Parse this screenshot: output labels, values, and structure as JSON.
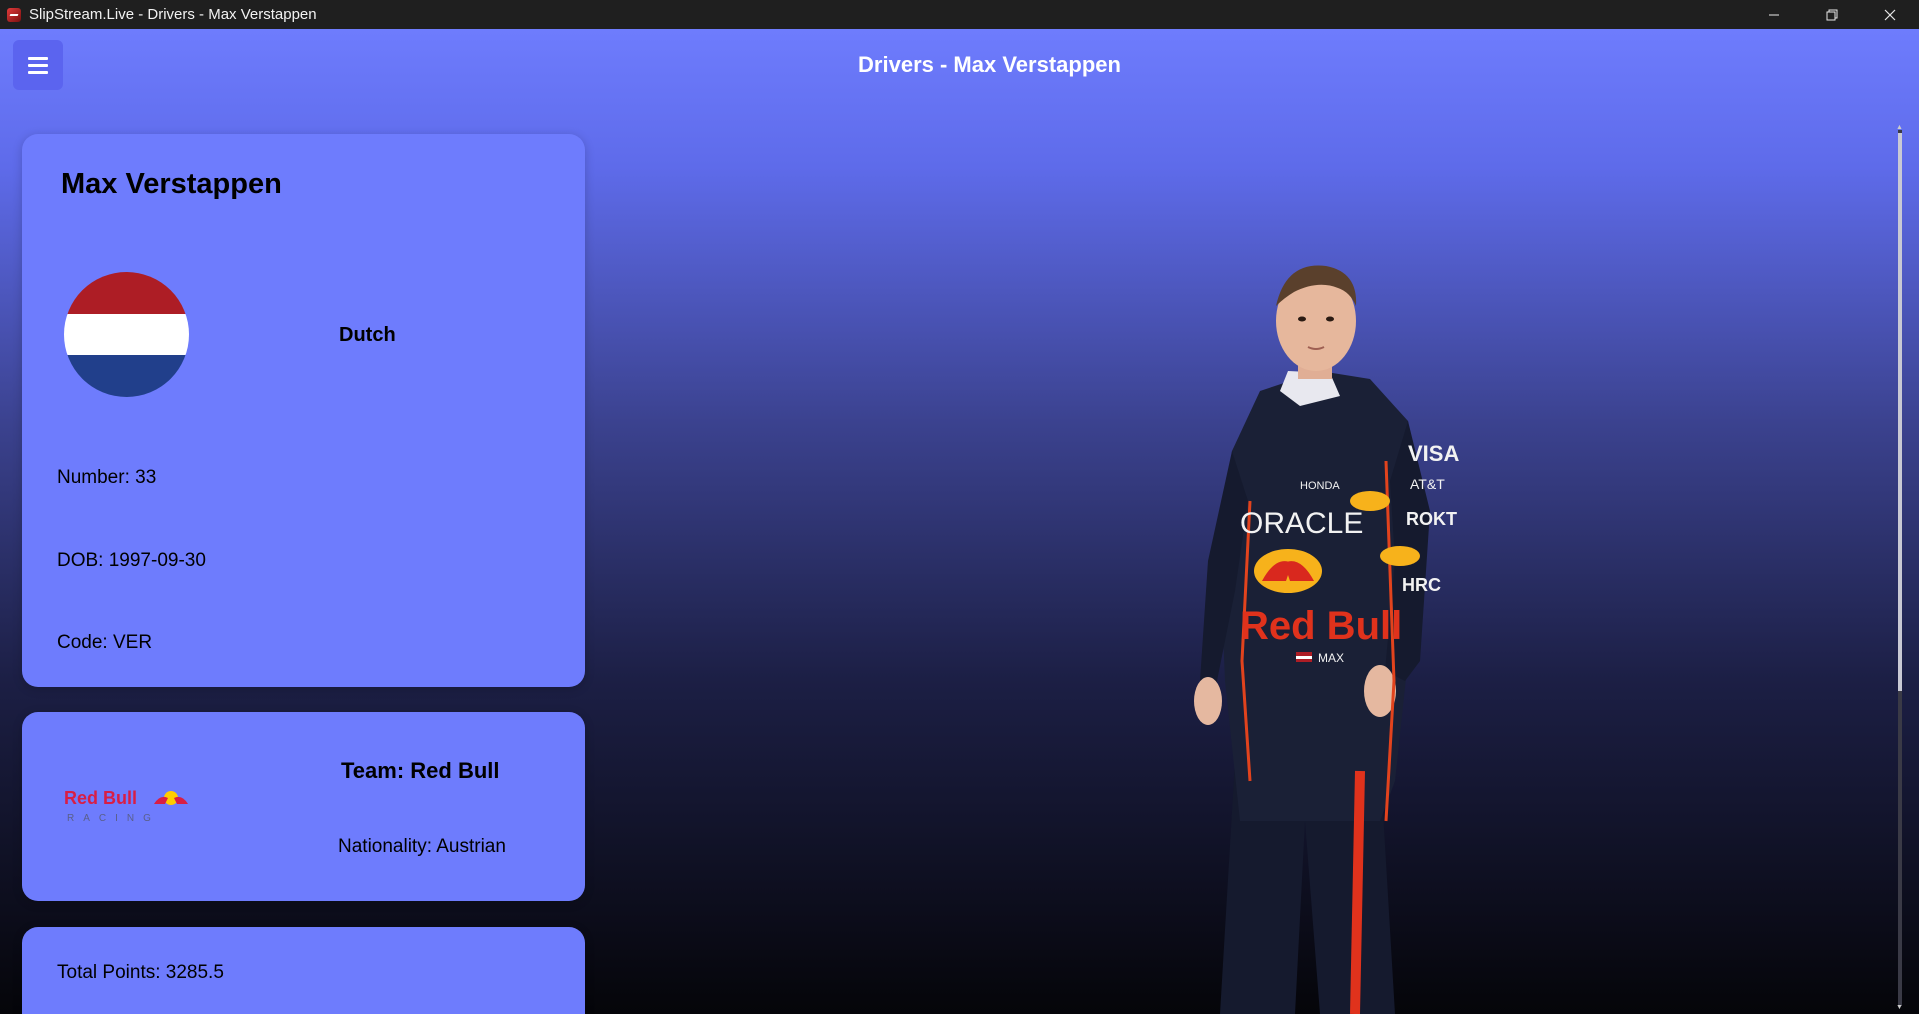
{
  "window": {
    "title": "SlipStream.Live - Drivers - Max Verstappen",
    "controls": {
      "minimize": "—",
      "restore": "❐",
      "close": "✕"
    }
  },
  "header": {
    "page_title": "Drivers - Max Verstappen",
    "menu_icon": "hamburger-menu-icon"
  },
  "driver": {
    "name": "Max Verstappen",
    "flag": {
      "country": "Netherlands",
      "colors": [
        "#ad1d25",
        "#ffffff",
        "#213f8b"
      ]
    },
    "nationality": "Dutch",
    "number_line": "Number: 33",
    "dob_line": "DOB: 1997-09-30",
    "code_line": "Code: VER"
  },
  "team": {
    "logo_text": "Red Bull",
    "logo_subtext": "RACING",
    "team_line": "Team: Red Bull",
    "nationality_line": "Nationality: Austrian"
  },
  "stats": {
    "total_points_line": "Total Points: 3285.5"
  },
  "photo": {
    "suit_texts": [
      "ORACLE",
      "Red Bull",
      "VISA",
      "AT&T",
      "ROKT",
      "HRC",
      "HONDA",
      "MAX"
    ]
  },
  "colors": {
    "card_bg": "#6e7cfd",
    "menu_button": "#5b64ef",
    "titlebar": "#1f1f1f"
  }
}
